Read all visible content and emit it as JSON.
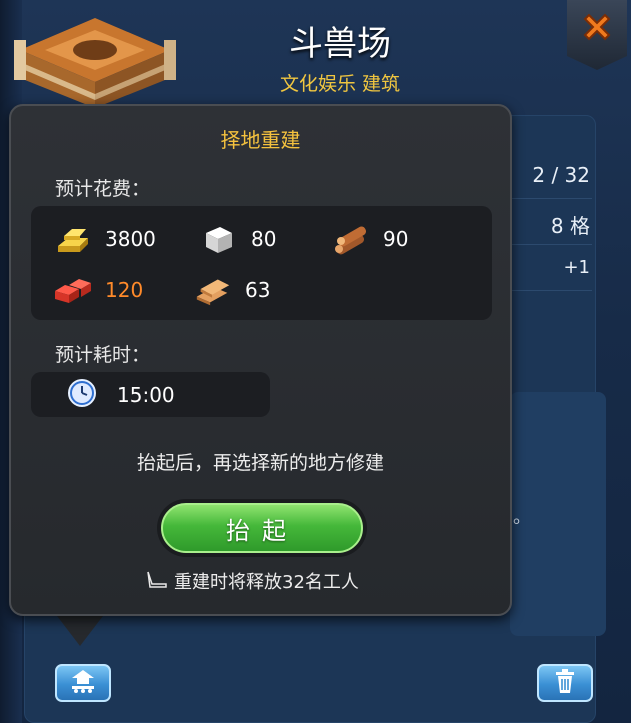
{
  "header": {
    "title": "斗兽场",
    "subtitle": "文化娱乐 建筑"
  },
  "background_info": {
    "row1": "2 / 32",
    "row2": "8 格",
    "row3": "+1",
    "fragment": "。"
  },
  "popup": {
    "title": "择地重建",
    "cost_label": "预计花费：",
    "resources": [
      {
        "name": "gold",
        "icon": "gold-bar-icon",
        "value": "3800"
      },
      {
        "name": "stone",
        "icon": "stone-block-icon",
        "value": "80"
      },
      {
        "name": "wood",
        "icon": "wood-log-icon",
        "value": "90"
      },
      {
        "name": "brick",
        "icon": "brick-icon",
        "value": "120",
        "insufficient": true
      },
      {
        "name": "plank",
        "icon": "plank-icon",
        "value": "63"
      }
    ],
    "time_label": "预计耗时：",
    "time_value": "15:00",
    "hint": "抬起后，再选择新的地方修建",
    "lift_button": "抬起",
    "workers_note": "重建时将释放32名工人"
  },
  "colors": {
    "accent_title": "#f5c23e",
    "warning": "#ff8a2a",
    "button_green": "#45b83a",
    "button_blue": "#3a8fd4"
  }
}
